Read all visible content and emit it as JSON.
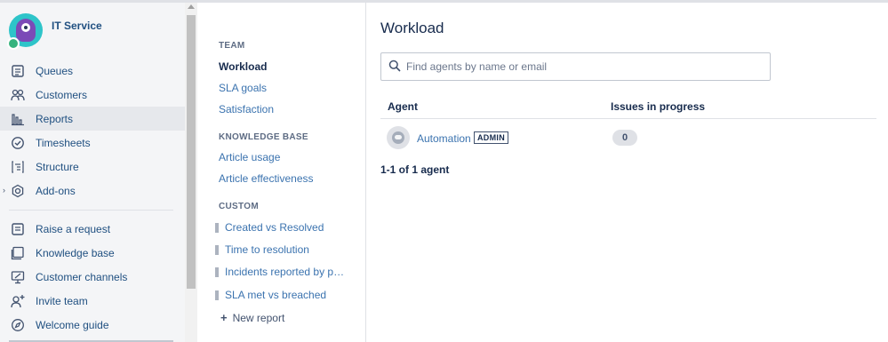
{
  "sidebar": {
    "project_name": "IT Service",
    "items": [
      {
        "label": "Queues",
        "icon": "queues-icon"
      },
      {
        "label": "Customers",
        "icon": "customers-icon"
      },
      {
        "label": "Reports",
        "icon": "reports-icon",
        "active": true
      },
      {
        "label": "Timesheets",
        "icon": "timesheets-icon"
      },
      {
        "label": "Structure",
        "icon": "structure-icon"
      },
      {
        "label": "Add-ons",
        "icon": "addons-icon"
      }
    ],
    "secondary_items": [
      {
        "label": "Raise a request",
        "icon": "raise-request-icon"
      },
      {
        "label": "Knowledge base",
        "icon": "knowledge-base-icon"
      },
      {
        "label": "Customer channels",
        "icon": "customer-channels-icon"
      },
      {
        "label": "Invite team",
        "icon": "invite-team-icon"
      },
      {
        "label": "Welcome guide",
        "icon": "compass-icon"
      }
    ]
  },
  "reports_nav": {
    "team_title": "TEAM",
    "team_items": [
      "Workload",
      "SLA goals",
      "Satisfaction"
    ],
    "kb_title": "KNOWLEDGE BASE",
    "kb_items": [
      "Article usage",
      "Article effectiveness"
    ],
    "custom_title": "CUSTOM",
    "custom_items": [
      "Created vs Resolved",
      "Time to resolution",
      "Incidents reported by p…",
      "SLA met vs breached"
    ],
    "new_report_label": "New report"
  },
  "main": {
    "title": "Workload",
    "search_placeholder": "Find agents by name or email",
    "columns": {
      "agent": "Agent",
      "issues": "Issues in progress"
    },
    "rows": [
      {
        "agent": "Automation",
        "badge": "ADMIN",
        "issues": "0"
      }
    ],
    "summary": "1-1 of 1 agent"
  },
  "colors": {
    "link": "#3b73af",
    "sidebar_link": "#205081",
    "sidebar_bg": "#f4f5f7",
    "avatar_teal": "#2ec4c9",
    "avatar_purple": "#7b4ab7"
  }
}
